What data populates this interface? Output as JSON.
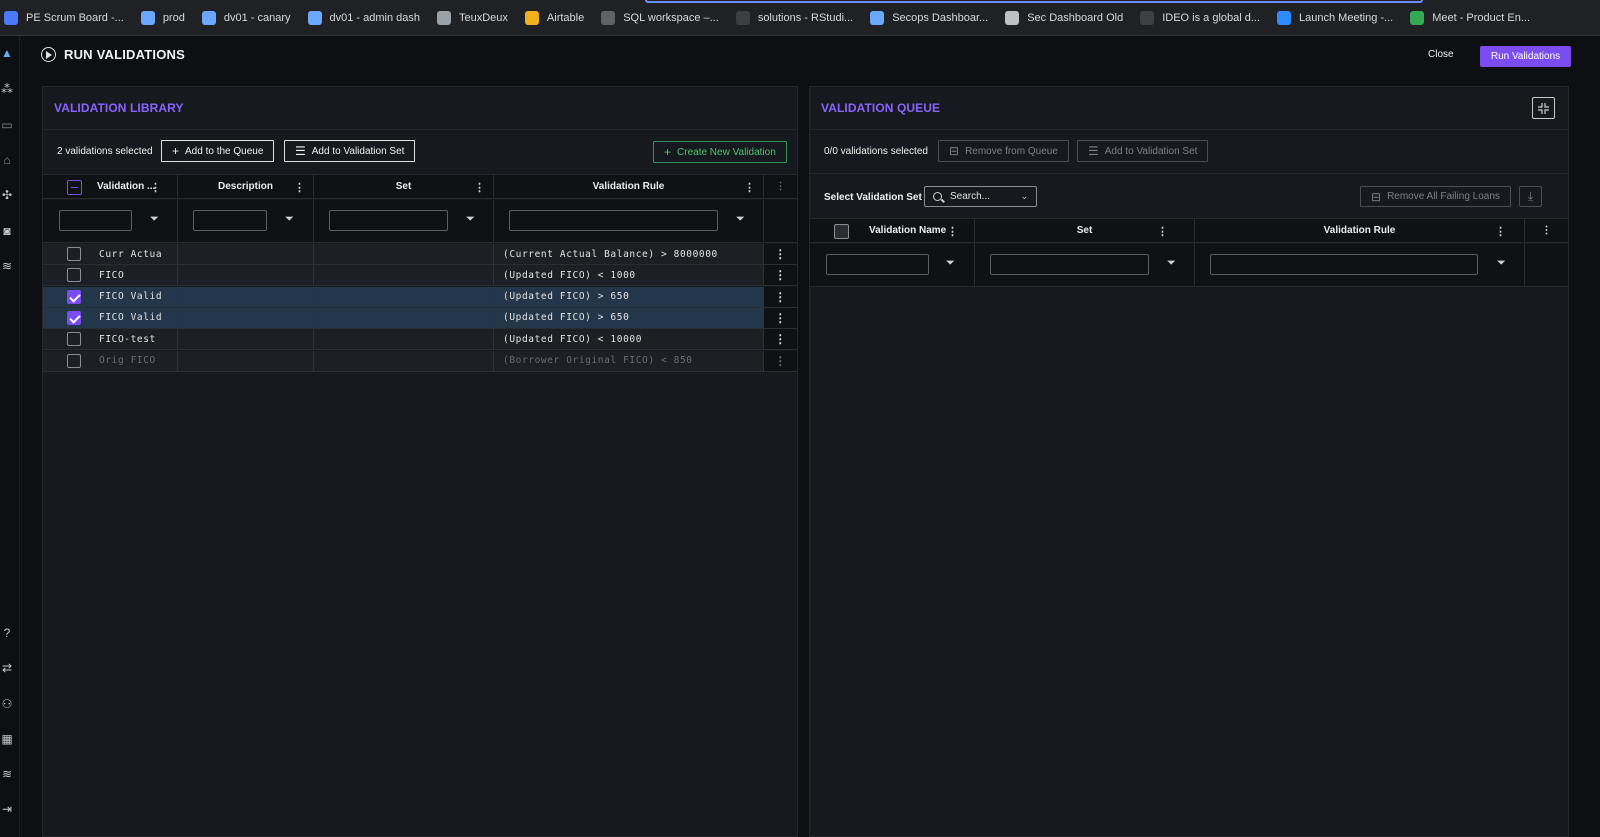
{
  "bookmarks": [
    {
      "label": "PE Scrum Board -...",
      "icon": "diamond-icon",
      "color": "#4b78ff"
    },
    {
      "label": "prod",
      "icon": "triangle-icon",
      "color": "#6aa8ff"
    },
    {
      "label": "dv01 - canary",
      "icon": "triangle-icon",
      "color": "#6aa8ff"
    },
    {
      "label": "dv01 - admin dash",
      "icon": "triangle-icon",
      "color": "#6aa8ff"
    },
    {
      "label": "TeuxDeux",
      "icon": "teuxdeux-icon",
      "color": "#9aa0a6"
    },
    {
      "label": "Airtable",
      "icon": "airtable-icon",
      "color": "#f2b01e"
    },
    {
      "label": "SQL workspace –...",
      "icon": "gear-icon",
      "color": "#5f6368"
    },
    {
      "label": "solutions - RStudi...",
      "icon": "r-icon",
      "color": "#3c4043"
    },
    {
      "label": "Secops Dashboar...",
      "icon": "triangle-icon",
      "color": "#6aa8ff"
    },
    {
      "label": "Sec Dashboard Old",
      "icon": "globe-icon",
      "color": "#bdc1c6"
    },
    {
      "label": "IDEO is a global d...",
      "icon": "ideo-icon",
      "color": "#3c4043"
    },
    {
      "label": "Launch Meeting -...",
      "icon": "zoom-icon",
      "color": "#2d8cff"
    },
    {
      "label": "Meet - Product En...",
      "icon": "meet-icon",
      "color": "#34a853"
    }
  ],
  "header": {
    "title": "RUN VALIDATIONS",
    "close_label": "Close",
    "run_label": "Run Validations"
  },
  "library": {
    "title": "VALIDATION LIBRARY",
    "selected_count": "2 validations selected",
    "add_queue_label": "Add to the Queue",
    "add_set_label": "Add to Validation Set",
    "create_label": "Create New Validation",
    "columns": [
      "Validation ...",
      "Description",
      "Set",
      "Validation Rule"
    ],
    "rows": [
      {
        "name": "Curr Actua",
        "description": "",
        "set": "",
        "rule": "(Current Actual Balance) > 8000000",
        "checked": false,
        "faded": false
      },
      {
        "name": "FICO",
        "description": "",
        "set": "",
        "rule": "(Updated FICO) < 1000",
        "checked": false,
        "faded": false
      },
      {
        "name": "FICO Valid",
        "description": "",
        "set": "",
        "rule": "(Updated FICO) > 650",
        "checked": true,
        "faded": false
      },
      {
        "name": "FICO Valid",
        "description": "",
        "set": "",
        "rule": "(Updated FICO) > 650",
        "checked": true,
        "faded": false
      },
      {
        "name": "FICO-test",
        "description": "",
        "set": "",
        "rule": "(Updated FICO) < 10000",
        "checked": false,
        "faded": false
      },
      {
        "name": "Orig FICO",
        "description": "",
        "set": "",
        "rule": "(Borrower Original FICO) < 850",
        "checked": false,
        "faded": true
      }
    ]
  },
  "queue": {
    "title": "VALIDATION QUEUE",
    "selected_count": "0/0 validations selected",
    "remove_label": "Remove from Queue",
    "add_set_label": "Add to Validation Set",
    "select_set_label": "Select Validation Set",
    "search_placeholder": "Search...",
    "remove_failing_label": "Remove All Failing Loans",
    "columns": [
      "Validation Name",
      "Set",
      "Validation Rule"
    ]
  },
  "colors": {
    "accent": "#7b4cf0",
    "panel_title": "#8a63ff",
    "create_green": "#4cc56d",
    "selected_row": "#243649"
  }
}
